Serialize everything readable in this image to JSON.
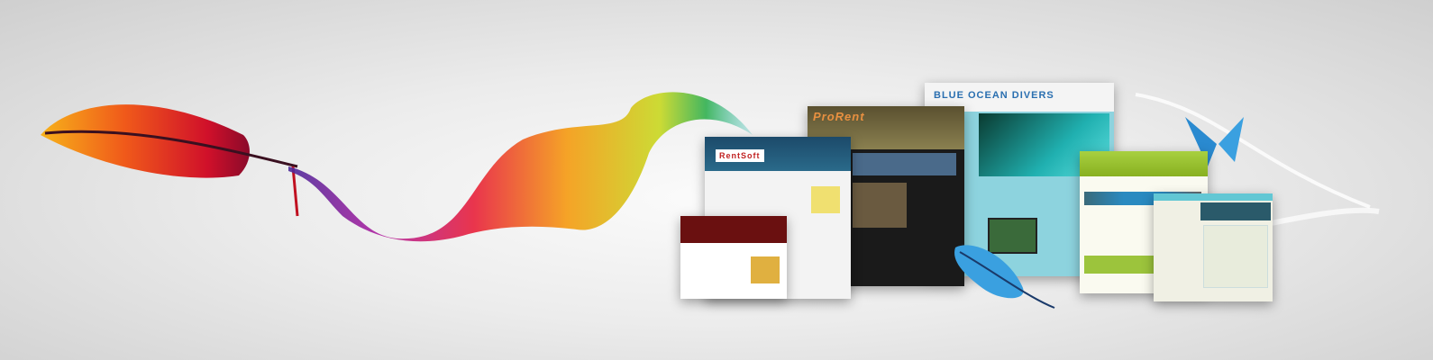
{
  "mockups": {
    "blue_ocean": {
      "title": "Blue Ocean Divers"
    },
    "pro_rent": {
      "title": "ProRent"
    },
    "rent_soft": {
      "title": "RentSoft"
    }
  },
  "colors": {
    "accent_blue": "#2a6fb0",
    "teal": "#62c7d4",
    "green": "#9cc43c",
    "dark_red": "#7a1212"
  }
}
